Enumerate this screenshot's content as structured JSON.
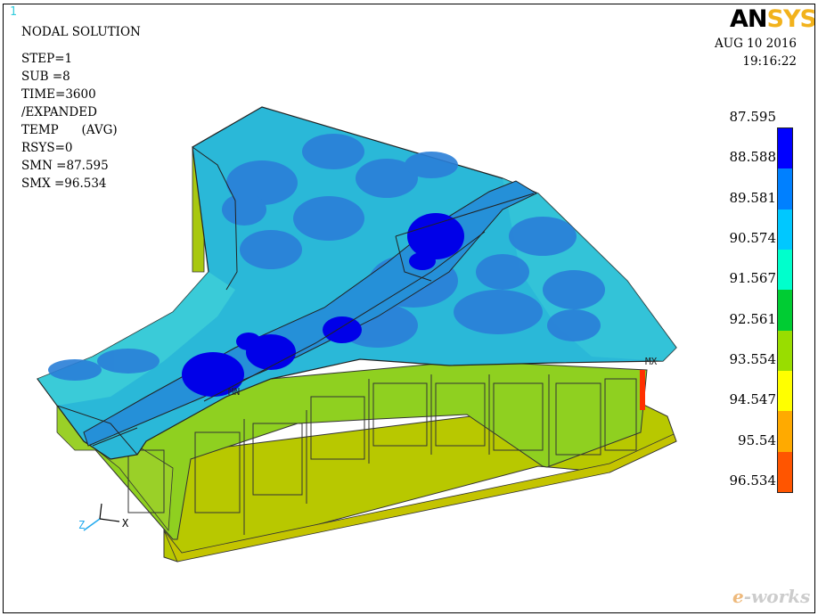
{
  "window": {
    "number": "1"
  },
  "info": {
    "title": "NODAL SOLUTION",
    "lines": [
      "STEP=1",
      "SUB =8",
      "TIME=3600",
      "/EXPANDED",
      "TEMP      (AVG)",
      "RSYS=0",
      "SMN =87.595",
      "SMX =96.534"
    ]
  },
  "logo": {
    "part1": "AN",
    "part2": "SYS"
  },
  "date": {
    "date": "AUG 10 2016",
    "time": "19:16:22"
  },
  "legend": {
    "values": [
      "87.595",
      "88.588",
      "89.581",
      "90.574",
      "91.567",
      "92.561",
      "93.554",
      "94.547",
      "95.54",
      "96.534"
    ],
    "colors": [
      "#0000ff",
      "#0080ff",
      "#00c8ff",
      "#00ffcc",
      "#00cc33",
      "#99dd00",
      "#ffff00",
      "#ffaa00",
      "#ff5500",
      "#ff0000"
    ]
  },
  "markers": {
    "min": "MN",
    "max": "MX"
  },
  "axes": {
    "z": "Z",
    "x": "X"
  },
  "watermark": {
    "part1": "e",
    "part2": "-works"
  }
}
